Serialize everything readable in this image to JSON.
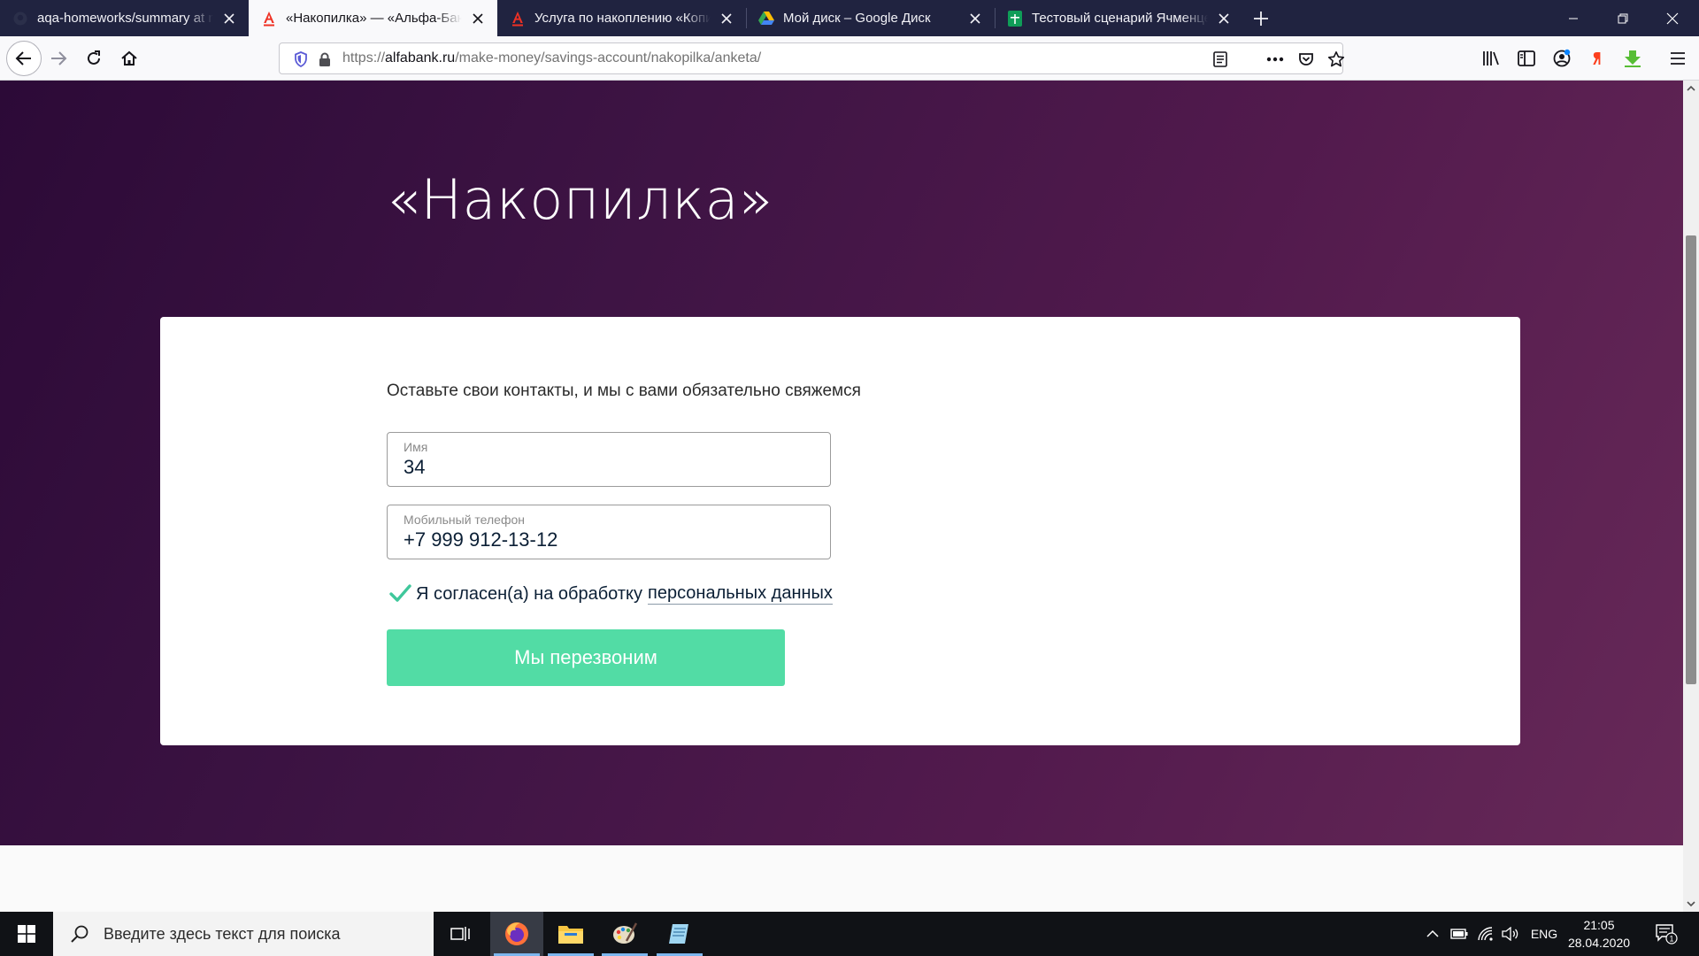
{
  "browser": {
    "tabs": [
      {
        "title": "aqa-homeworks/summary at m",
        "favicon": "github-icon",
        "active": false
      },
      {
        "title": "«Накопилка» — «Альфа-Банк",
        "favicon": "alfa-bank-icon",
        "active": true
      },
      {
        "title": "Услуга по накоплению «Копилка»",
        "favicon": "alfa-bank-icon",
        "active": false
      },
      {
        "title": "Мой диск – Google Диск",
        "favicon": "google-drive-icon",
        "active": false
      },
      {
        "title": "Тестовый сценарий Ячменцев",
        "favicon": "google-sheets-icon",
        "active": false
      }
    ],
    "url": {
      "scheme": "https://",
      "host": "alfabank.ru",
      "path": "/make-money/savings-account/nakopilka/anketa/"
    },
    "colors": {
      "tabstrip": "#202340",
      "alfa_red": "#ef3124"
    }
  },
  "page": {
    "hero_title": "«Накопилка»",
    "form": {
      "subtitle": "Оставьте свои контакты, и мы с вами обязательно свяжемся",
      "name_field": {
        "label": "Имя",
        "value": "34"
      },
      "phone_field": {
        "label": "Мобильный телефон",
        "value": "+7 999 912-13-12"
      },
      "agreement": {
        "text": "Я согласен(а) на обработку",
        "link": "персональных данных",
        "checked": true
      },
      "submit_label": "Мы перезвоним"
    },
    "colors": {
      "hero_start": "#2c0a37",
      "hero_end": "#672958",
      "accent_green": "#52dca5"
    }
  },
  "taskbar": {
    "search_placeholder": "Введите здесь текст для поиска",
    "language": "ENG",
    "time": "21:05",
    "date": "28.04.2020",
    "notification_count": "1"
  }
}
